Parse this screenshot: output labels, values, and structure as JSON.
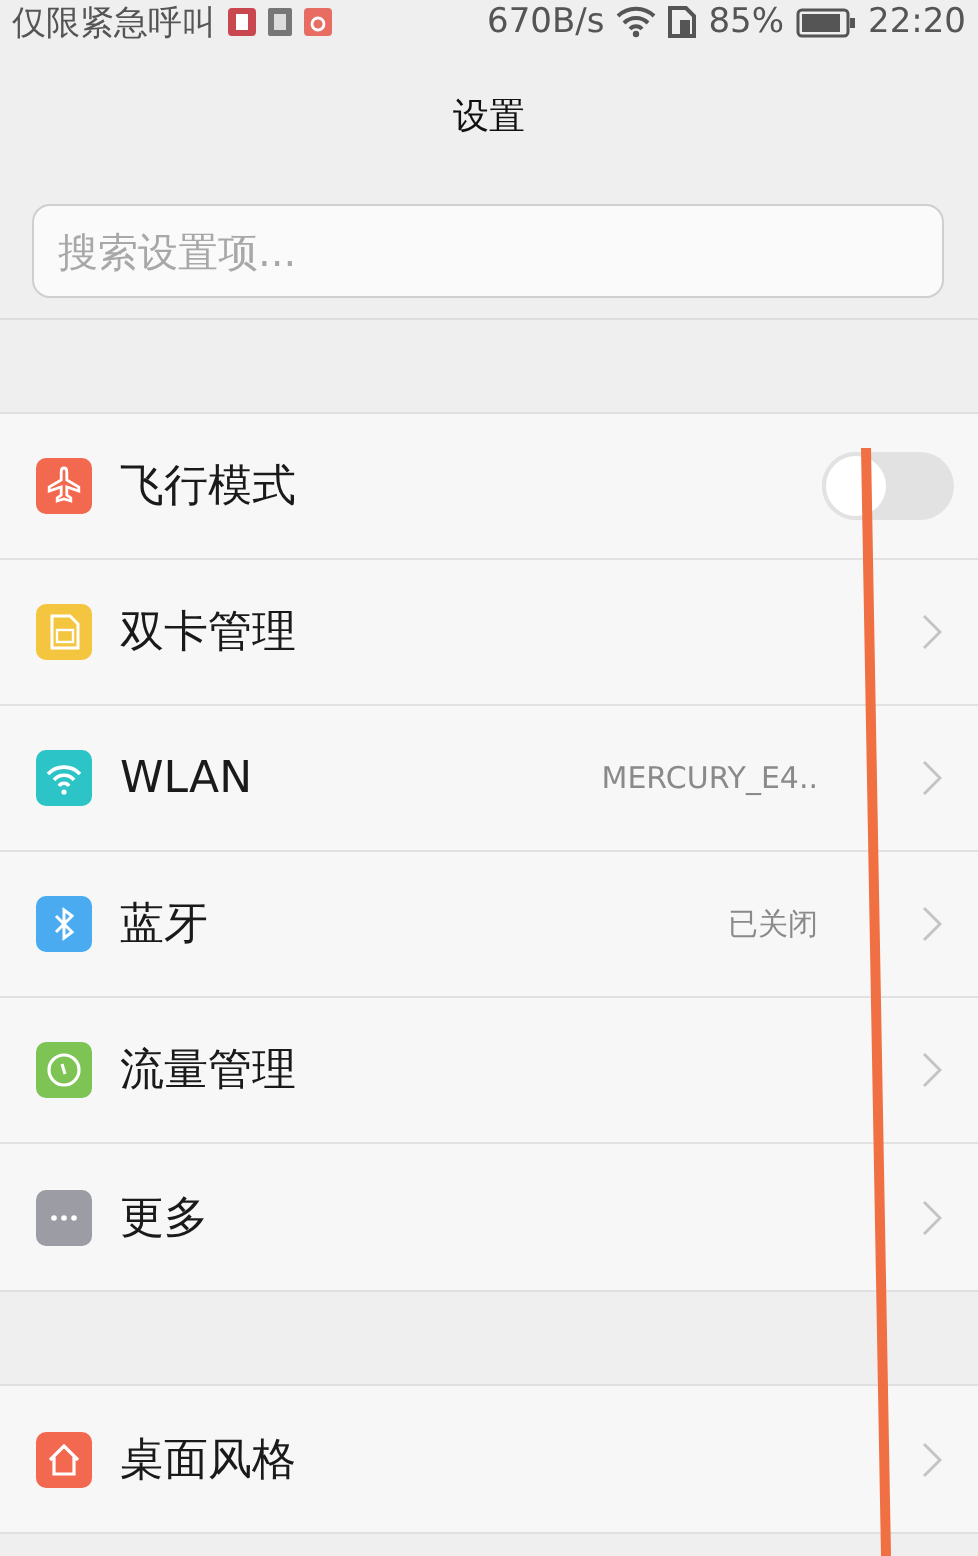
{
  "status_bar": {
    "carrier": "仅限紧急呼叫",
    "speed": "670B/s",
    "battery": "85%",
    "time": "22:20"
  },
  "title": "设置",
  "search": {
    "placeholder": "搜索设置项..."
  },
  "sections": [
    {
      "rows": [
        {
          "kind": "toggle",
          "label": "飞行模式",
          "on": false
        },
        {
          "kind": "link",
          "label": "双卡管理"
        },
        {
          "kind": "link",
          "label": "WLAN",
          "value": "MERCURY_E4.."
        },
        {
          "kind": "link",
          "label": "蓝牙",
          "value": "已关闭"
        },
        {
          "kind": "link",
          "label": "流量管理"
        },
        {
          "kind": "link",
          "label": "更多"
        }
      ]
    },
    {
      "rows": [
        {
          "kind": "link",
          "label": "桌面风格"
        }
      ]
    }
  ]
}
